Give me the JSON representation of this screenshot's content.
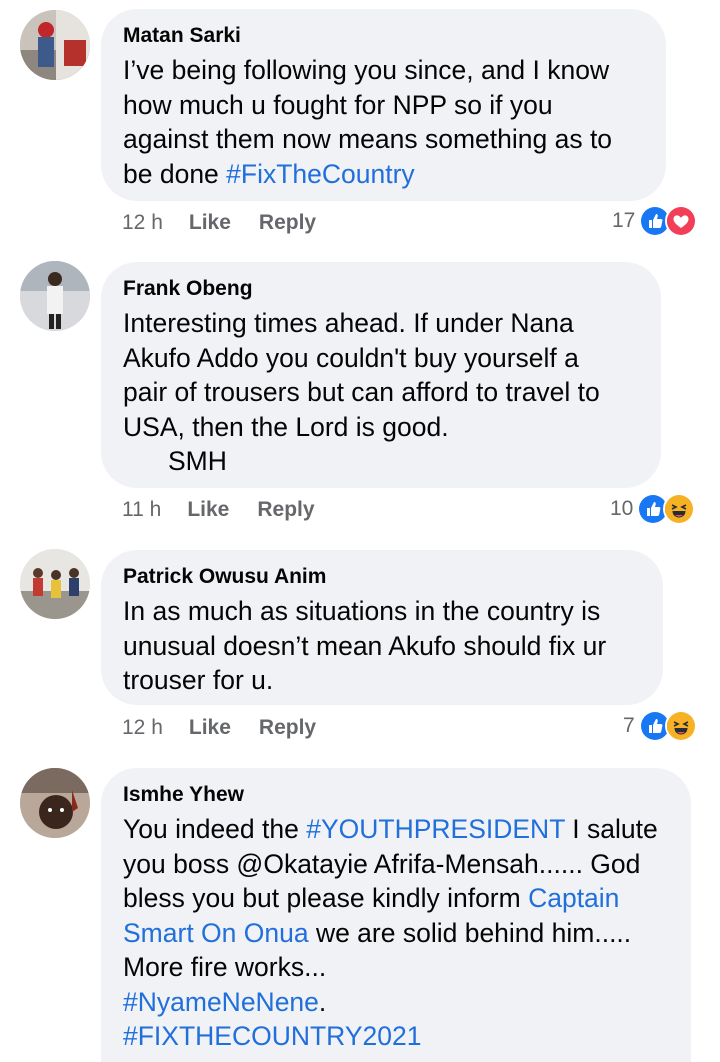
{
  "comments": [
    {
      "author": "Matan Sarki",
      "lines": [
        "I’ve being following you since, and I know",
        "how much u fought for NPP so if you",
        "against them now means something as to"
      ],
      "last_line_prefix": "be done ",
      "last_line_tag": "#FixTheCountry",
      "time": "12 h",
      "like_label": "Like",
      "reply_label": "Reply",
      "reaction_count": "17",
      "reactions": [
        "like-icon",
        "love-icon"
      ]
    },
    {
      "author": "Frank Obeng",
      "lines": [
        "Interesting times ahead. If under Nana",
        "Akufo Addo you couldn't buy  yourself a",
        "pair of trousers but can afford to travel to",
        "USA, then the Lord is good.",
        "SMH"
      ],
      "time": "11 h",
      "like_label": "Like",
      "reply_label": "Reply",
      "reaction_count": "10",
      "reactions": [
        "like-icon",
        "haha-icon"
      ]
    },
    {
      "author": "Patrick Owusu Anim",
      "lines": [
        "In as much as situations in the country is",
        "unusual doesn’t mean Akufo should fix ur",
        "trouser for u."
      ],
      "time": "12 h",
      "like_label": "Like",
      "reply_label": "Reply",
      "reaction_count": "7",
      "reactions": [
        "like-icon",
        "haha-icon"
      ]
    },
    {
      "author": "Ismhe Yhew",
      "line1_prefix": "You indeed the ",
      "line1_tag": "#YOUTHPRESIDENT",
      "line1_suffix": " I salute",
      "line2": "you boss @Okatayie Afrifa-Mensah...... God",
      "line3_prefix": "bless you but please kindly inform ",
      "line3_link": "Captain",
      "line4_link": "Smart On Onua",
      "line4_suffix": " we are solid behind him.....",
      "line5": "More fire works...",
      "tag1": "#NyameNeNene",
      "tag1_suffix": ".",
      "tag2": "#FIXTHECOUNTRY2021"
    }
  ],
  "colors": {
    "bubble": "#f0f2f5",
    "link": "#216fdb",
    "meta": "#65676b",
    "like_blue": "#1877f2",
    "love_red": "#f33e58",
    "haha_yellow": "#f7b125"
  }
}
